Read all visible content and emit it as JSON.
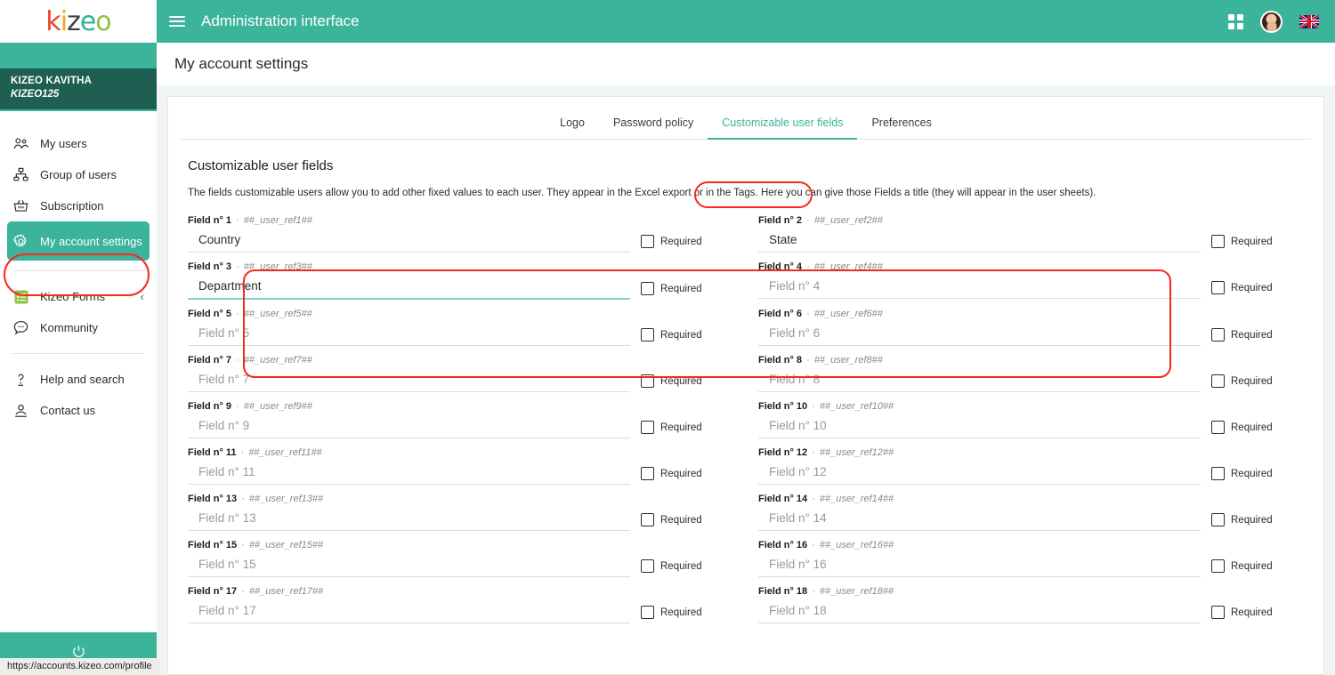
{
  "brand": {
    "logo_parts": [
      "k",
      "i",
      "z",
      "e",
      "o"
    ],
    "accent_teal": "#3cb39b",
    "dark_teal": "#1f5f52",
    "highlight_red": "#f5291f"
  },
  "sidebar": {
    "user_name": "KIZEO KAVITHA",
    "user_id": "KIZEO125",
    "items": [
      {
        "label": "My users",
        "icon": "users-icon",
        "active": false
      },
      {
        "label": "Group of users",
        "icon": "group-tree-icon",
        "active": false
      },
      {
        "label": "Subscription",
        "icon": "basket-icon",
        "active": false
      },
      {
        "label": "My account settings",
        "icon": "gear-icon",
        "active": true
      }
    ],
    "apps": [
      {
        "label": "Kizeo Forms",
        "icon": "forms-list-icon",
        "chevron": "‹"
      },
      {
        "label": "Kommunity",
        "icon": "chat-bubble-icon"
      }
    ],
    "support": [
      {
        "label": "Help and search",
        "icon": "help-question-icon"
      },
      {
        "label": "Contact us",
        "icon": "person-contact-icon"
      }
    ],
    "logout_icon": "power-icon",
    "status_url": "https://accounts.kizeo.com/profile"
  },
  "topbar": {
    "menu_icon": "hamburger-menu-icon",
    "title": "Administration interface",
    "apps_icon": "grid-apps-icon",
    "avatar_icon": "user-avatar",
    "language_icon": "uk-flag-icon"
  },
  "page": {
    "title": "My account settings"
  },
  "tabs": [
    {
      "label": "Logo",
      "active": false
    },
    {
      "label": "Password policy",
      "active": false
    },
    {
      "label": "Customizable user fields",
      "active": true
    },
    {
      "label": "Preferences",
      "active": false
    }
  ],
  "section": {
    "title": "Customizable user fields",
    "description": "The fields customizable users allow you to add other fixed values to each user. They appear in the Excel export or in the Tags. Here you can give those Fields a title (they will appear in the user sheets).",
    "required_label": "Required"
  },
  "fields": [
    {
      "label": "Field n° 1",
      "sep": "·",
      "ref": "##_user_ref1##",
      "value": "Country",
      "placeholder": "Field n° 1",
      "filled": true,
      "focused": false,
      "required": false
    },
    {
      "label": "Field n° 2",
      "sep": "·",
      "ref": "##_user_ref2##",
      "value": "State",
      "placeholder": "Field n° 2",
      "filled": true,
      "focused": false,
      "required": false
    },
    {
      "label": "Field n° 3",
      "sep": "·",
      "ref": "##_user_ref3##",
      "value": "Department",
      "placeholder": "Field n° 3",
      "filled": true,
      "focused": true,
      "required": false
    },
    {
      "label": "Field n° 4",
      "sep": "·",
      "ref": "##_user_ref4##",
      "value": "",
      "placeholder": "Field n° 4",
      "filled": false,
      "focused": false,
      "required": false
    },
    {
      "label": "Field n° 5",
      "sep": "·",
      "ref": "##_user_ref5##",
      "value": "",
      "placeholder": "Field n° 5",
      "filled": false,
      "focused": false,
      "required": false
    },
    {
      "label": "Field n° 6",
      "sep": "·",
      "ref": "##_user_ref6##",
      "value": "",
      "placeholder": "Field n° 6",
      "filled": false,
      "focused": false,
      "required": false
    },
    {
      "label": "Field n° 7",
      "sep": "·",
      "ref": "##_user_ref7##",
      "value": "",
      "placeholder": "Field n° 7",
      "filled": false,
      "focused": false,
      "required": false
    },
    {
      "label": "Field n° 8",
      "sep": "·",
      "ref": "##_user_ref8##",
      "value": "",
      "placeholder": "Field n° 8",
      "filled": false,
      "focused": false,
      "required": false
    },
    {
      "label": "Field n° 9",
      "sep": "·",
      "ref": "##_user_ref9##",
      "value": "",
      "placeholder": "Field n° 9",
      "filled": false,
      "focused": false,
      "required": false
    },
    {
      "label": "Field n° 10",
      "sep": "·",
      "ref": "##_user_ref10##",
      "value": "",
      "placeholder": "Field n° 10",
      "filled": false,
      "focused": false,
      "required": false
    },
    {
      "label": "Field n° 11",
      "sep": "·",
      "ref": "##_user_ref11##",
      "value": "",
      "placeholder": "Field n° 11",
      "filled": false,
      "focused": false,
      "required": false
    },
    {
      "label": "Field n° 12",
      "sep": "·",
      "ref": "##_user_ref12##",
      "value": "",
      "placeholder": "Field n° 12",
      "filled": false,
      "focused": false,
      "required": false
    },
    {
      "label": "Field n° 13",
      "sep": "·",
      "ref": "##_user_ref13##",
      "value": "",
      "placeholder": "Field n° 13",
      "filled": false,
      "focused": false,
      "required": false
    },
    {
      "label": "Field n° 14",
      "sep": "·",
      "ref": "##_user_ref14##",
      "value": "",
      "placeholder": "Field n° 14",
      "filled": false,
      "focused": false,
      "required": false
    },
    {
      "label": "Field n° 15",
      "sep": "·",
      "ref": "##_user_ref15##",
      "value": "",
      "placeholder": "Field n° 15",
      "filled": false,
      "focused": false,
      "required": false
    },
    {
      "label": "Field n° 16",
      "sep": "·",
      "ref": "##_user_ref16##",
      "value": "",
      "placeholder": "Field n° 16",
      "filled": false,
      "focused": false,
      "required": false
    },
    {
      "label": "Field n° 17",
      "sep": "·",
      "ref": "##_user_ref17##",
      "value": "",
      "placeholder": "Field n° 17",
      "filled": false,
      "focused": false,
      "required": false
    },
    {
      "label": "Field n° 18",
      "sep": "·",
      "ref": "##_user_ref18##",
      "value": "",
      "placeholder": "Field n° 18",
      "filled": false,
      "focused": false,
      "required": false
    }
  ]
}
